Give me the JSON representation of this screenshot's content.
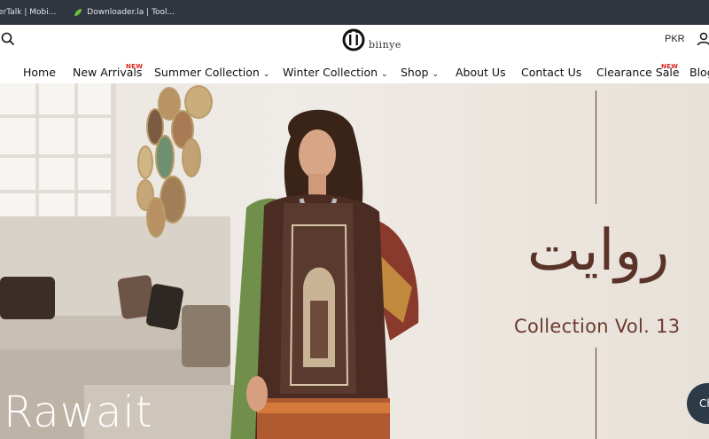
{
  "bookmarks": [
    {
      "label": "erTalk | Mobi...",
      "icon": "page-icon"
    },
    {
      "label": "Downloader.la | Tool...",
      "icon": "leaf-icon"
    }
  ],
  "header": {
    "logo_text": "biinye",
    "currency": "PKR"
  },
  "nav": {
    "items": [
      {
        "label": "Home"
      },
      {
        "label": "New Arrivals",
        "badge": "NEW"
      },
      {
        "label": "Summer Collection",
        "dropdown": true
      },
      {
        "label": "Winter Collection",
        "dropdown": true
      },
      {
        "label": "Shop",
        "dropdown": true
      },
      {
        "label": "About Us"
      },
      {
        "label": "Contact Us"
      },
      {
        "label": "Clearance Sale",
        "badge": "NEW"
      },
      {
        "label": "Blog"
      }
    ]
  },
  "hero": {
    "urdu_title": "روایت",
    "collection_label": "Collection Vol. 13",
    "title": "Rawait"
  },
  "chat": {
    "label": "Ch"
  },
  "colors": {
    "accent_brown": "#6b3a2e",
    "badge_red": "#d9241f",
    "bookmarks_bg": "#2f3640"
  }
}
